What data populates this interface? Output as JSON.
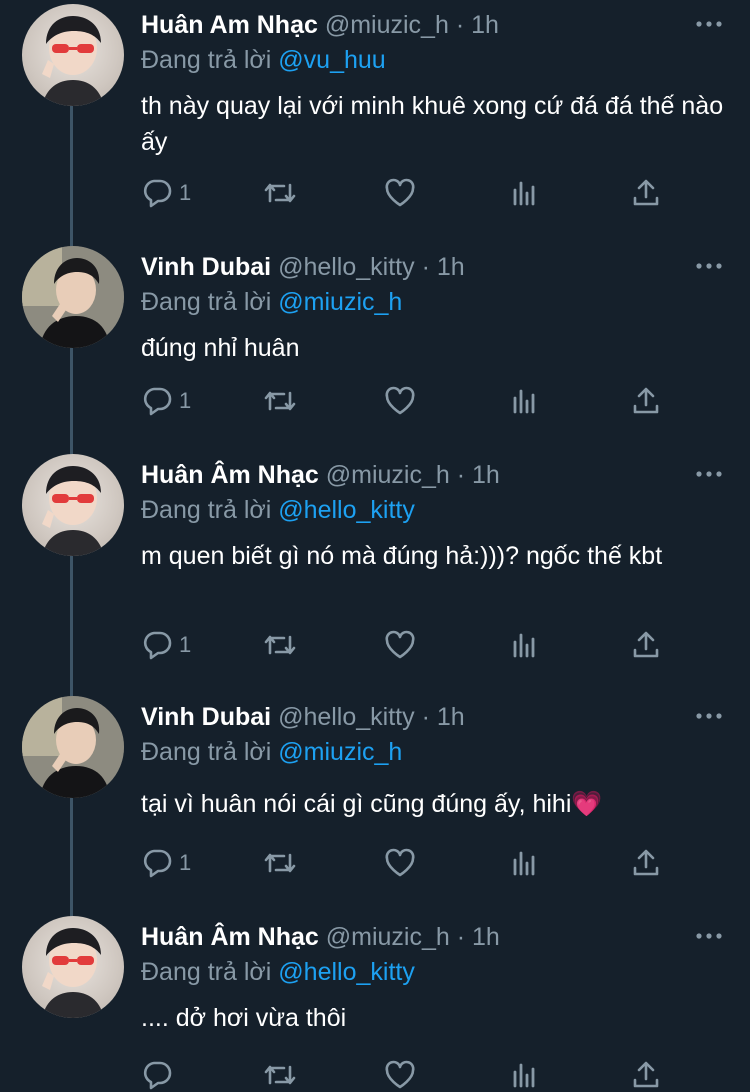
{
  "tweets": [
    {
      "name": "Huân Am Nhạc",
      "handle": "@miuzic_h",
      "dot": "·",
      "time": "1h",
      "reply_prefix": "Đang trả lời",
      "reply_to": "@vu_huu",
      "text": "th này quay lại với minh khuê xong cứ đá đá thế nào ấy",
      "reply_count": "1",
      "avatar": "huan"
    },
    {
      "name": "Vinh Dubai",
      "handle": "@hello_kitty",
      "dot": "·",
      "time": "1h",
      "reply_prefix": "Đang trả lời",
      "reply_to": "@miuzic_h",
      "text": "đúng nhỉ huân",
      "reply_count": "1",
      "avatar": "vinh"
    },
    {
      "name": "Huân Âm Nhạc",
      "handle": "@miuzic_h",
      "dot": "·",
      "time": "1h",
      "reply_prefix": "Đang trả lời",
      "reply_to": "@hello_kitty",
      "text": "m quen biết gì nó mà đúng hả:)))? ngốc thế kbt",
      "reply_count": "1",
      "avatar": "huan"
    },
    {
      "name": "Vinh Dubai",
      "handle": "@hello_kitty",
      "dot": "·",
      "time": "1h",
      "reply_prefix": "Đang trả lời",
      "reply_to": "@miuzic_h",
      "text": "tại vì huân nói cái gì cũng đúng ấy, hihi💗",
      "reply_count": "1",
      "avatar": "vinh"
    },
    {
      "name": "Huân Âm Nhạc",
      "handle": "@miuzic_h",
      "dot": "·",
      "time": "1h",
      "reply_prefix": "Đang trả lời",
      "reply_to": "@hello_kitty",
      "text": ".... dở hơi vừa thôi",
      "reply_count": "",
      "avatar": "huan"
    }
  ],
  "icons": {
    "reply": "reply-icon",
    "retweet": "retweet-icon",
    "like": "like-icon",
    "analytics": "analytics-icon",
    "share": "share-icon",
    "more": "more-icon"
  },
  "colors": {
    "background": "#15202b",
    "text": "#ffffff",
    "secondary": "#8899a6",
    "mention": "#1da1f2",
    "thread_line": "#3d5466"
  }
}
